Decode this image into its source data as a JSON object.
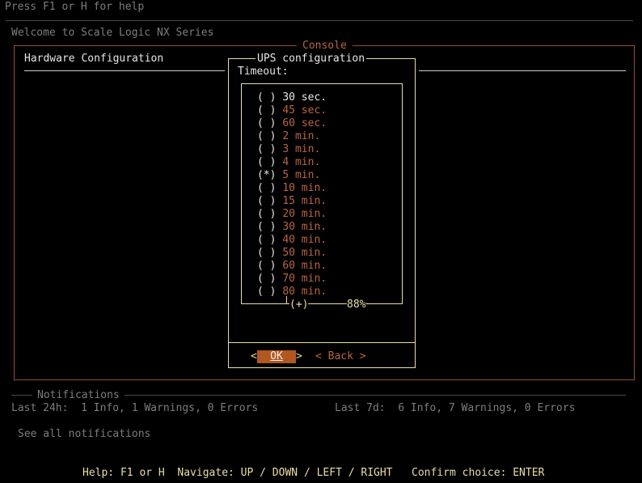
{
  "header": {
    "help_hint": "Press F1 or H for help",
    "welcome": "Welcome to Scale Logic NX Series"
  },
  "console": {
    "title": "Console",
    "section_title": "Hardware Configuration"
  },
  "dialog": {
    "title": "UPS configuration",
    "field_label": "Timeout:",
    "options": [
      {
        "mark": "( )",
        "label": "30 sec."
      },
      {
        "mark": "( )",
        "label": "45 sec."
      },
      {
        "mark": "( )",
        "label": "60 sec."
      },
      {
        "mark": "( )",
        "label": "2 min."
      },
      {
        "mark": "( )",
        "label": "3 min."
      },
      {
        "mark": "( )",
        "label": "4 min."
      },
      {
        "mark": "(*)",
        "label": "5 min."
      },
      {
        "mark": "( )",
        "label": "10 min."
      },
      {
        "mark": "( )",
        "label": "15 min."
      },
      {
        "mark": "( )",
        "label": "20 min."
      },
      {
        "mark": "( )",
        "label": "30 min."
      },
      {
        "mark": "( )",
        "label": "40 min."
      },
      {
        "mark": "( )",
        "label": "50 min."
      },
      {
        "mark": "( )",
        "label": "60 min."
      },
      {
        "mark": "( )",
        "label": "70 min."
      },
      {
        "mark": "( )",
        "label": "80 min."
      }
    ],
    "scroll_more": "(+)",
    "scroll_percent": "88%",
    "ok_label": "OK",
    "ok_left": "<",
    "ok_right": ">",
    "back_label": "< Back >"
  },
  "notifications": {
    "title": "Notifications",
    "last_24h": "Last 24h:  1 Info, 1 Warnings, 0 Errors",
    "last_7d": "Last 7d:  6 Info, 7 Warnings, 0 Errors",
    "see_all": "See all notifications"
  },
  "footer": {
    "help": "Help: F1 or H",
    "navigate": "Navigate: UP / DOWN / LEFT / RIGHT",
    "confirm": "Confirm choice: ENTER"
  },
  "colors": {
    "background": "#000000",
    "frame_orange": "#9a4e2a",
    "dialog_border": "#e8dfa0",
    "ok_highlight": "#b0581e"
  }
}
